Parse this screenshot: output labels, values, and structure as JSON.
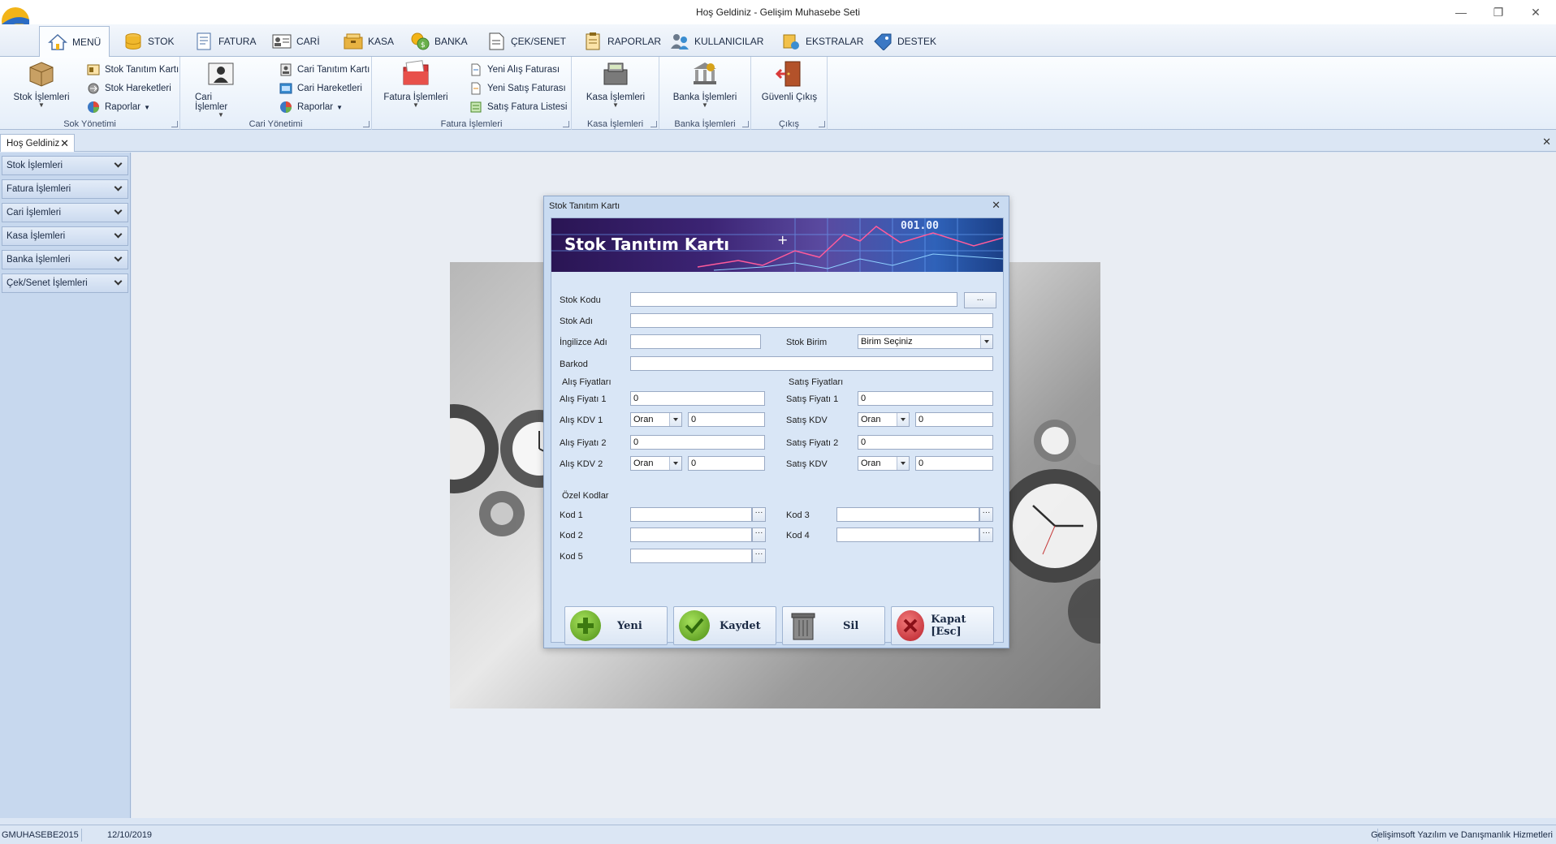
{
  "window": {
    "title": "Hoş Geldiniz - Gelişim Muhasebe Seti",
    "minimize": "—",
    "restore": "❐",
    "close": "✕"
  },
  "ribbon_tabs": [
    {
      "label": "MENÜ",
      "icon": "home-icon",
      "active": true
    },
    {
      "label": "STOK",
      "icon": "database-icon"
    },
    {
      "label": "FATURA",
      "icon": "invoice-icon"
    },
    {
      "label": "CARİ",
      "icon": "contact-card-icon"
    },
    {
      "label": "KASA",
      "icon": "cash-box-icon"
    },
    {
      "label": "BANKA",
      "icon": "bank-coins-icon"
    },
    {
      "label": "ÇEK/SENET",
      "icon": "document-icon"
    },
    {
      "label": "RAPORLAR",
      "icon": "clipboard-icon"
    },
    {
      "label": "KULLANICILAR",
      "icon": "users-icon"
    },
    {
      "label": "EKSTRALAR",
      "icon": "extras-icon"
    },
    {
      "label": "DESTEK",
      "icon": "tag-icon"
    }
  ],
  "ribbon": {
    "stok_group": {
      "label": "Sok Yönetimi",
      "big": "Stok İşlemleri",
      "items": [
        "Stok Tanıtım Kartı",
        "Stok Hareketleri",
        "Raporlar"
      ]
    },
    "cari_group": {
      "label": "Cari Yönetimi",
      "big": "Cari İşlemler",
      "items": [
        "Cari Tanıtım Kartı",
        "Cari Hareketleri",
        "Raporlar"
      ]
    },
    "fatura_group": {
      "label": "Fatura İşlemleri",
      "big": "Fatura İşlemleri",
      "items": [
        "Yeni Alış Faturası",
        "Yeni Satış Faturası",
        "Satış Fatura Listesi"
      ]
    },
    "kasa_group": {
      "label": "Kasa İşlemleri",
      "big": "Kasa İşlemleri"
    },
    "banka_group": {
      "label": "Banka İşlemleri",
      "big": "Banka İşlemleri"
    },
    "cikis_group": {
      "label": "Çıkış",
      "big": "Güvenli Çıkış"
    }
  },
  "doc_tab": {
    "label": "Hoş Geldiniz",
    "close": "✕"
  },
  "doc_strip_close": "✕",
  "left_nav": [
    "Stok İşlemleri",
    "Fatura İşlemleri",
    "Cari İşlemleri",
    "Kasa İşlemleri",
    "Banka İşlemleri",
    "Çek/Senet İşlemleri"
  ],
  "dialog": {
    "title": "Stok Tanıtım Kartı",
    "close": "✕",
    "banner_title": "Stok Tanıtım Kartı",
    "banner_number": "001.00",
    "fields": {
      "stok_kodu": {
        "label": "Stok Kodu",
        "value": "",
        "button": "..."
      },
      "stok_adi": {
        "label": "Stok Adı",
        "value": ""
      },
      "ingilizce_adi": {
        "label": "İngilizce Adı",
        "value": ""
      },
      "stok_birim": {
        "label": "Stok Birim",
        "value": "Birim Seçiniz"
      },
      "barkod": {
        "label": "Barkod",
        "value": ""
      }
    },
    "alis": {
      "section": "Alış Fiyatları",
      "fiyat1_label": "Alış Fiyatı 1",
      "fiyat1": "0",
      "kdv1_label": "Alış KDV 1",
      "kdv1_combo": "Oran",
      "kdv1": "0",
      "fiyat2_label": "Alış Fiyatı 2",
      "fiyat2": "0",
      "kdv2_label": "Alış KDV 2",
      "kdv2_combo": "Oran",
      "kdv2": "0"
    },
    "satis": {
      "section": "Satış Fiyatları",
      "fiyat1_label": "Satış Fiyatı 1",
      "fiyat1": "0",
      "kdv1_label": "Satış KDV",
      "kdv1_combo": "Oran",
      "kdv1": "0",
      "fiyat2_label": "Satış Fiyatı 2",
      "fiyat2": "0",
      "kdv2_label": "Satış KDV",
      "kdv2_combo": "Oran",
      "kdv2": "0"
    },
    "ozel": {
      "section": "Özel Kodlar",
      "kod1": "Kod 1",
      "kod2": "Kod 2",
      "kod3": "Kod 3",
      "kod4": "Kod 4",
      "kod5": "Kod 5",
      "ellipsis": "···"
    },
    "buttons": {
      "yeni": "Yeni",
      "kaydet": "Kaydet",
      "sil": "Sil",
      "kapat": "Kapat [Esc]"
    }
  },
  "status": {
    "db": "GMUHASEBE2015",
    "date": "12/10/2019",
    "company": "Gelişimsoft Yazılım ve Danışmanlık Hizmetleri"
  },
  "colors": {
    "ribbon_bg": "#e5eef9",
    "dialog_bg": "#d9e6f6",
    "banner_dark": "#2a1554",
    "banner_light": "#2f62b9",
    "yeni_green": "#6aa820",
    "kapat_red": "#d53640"
  }
}
